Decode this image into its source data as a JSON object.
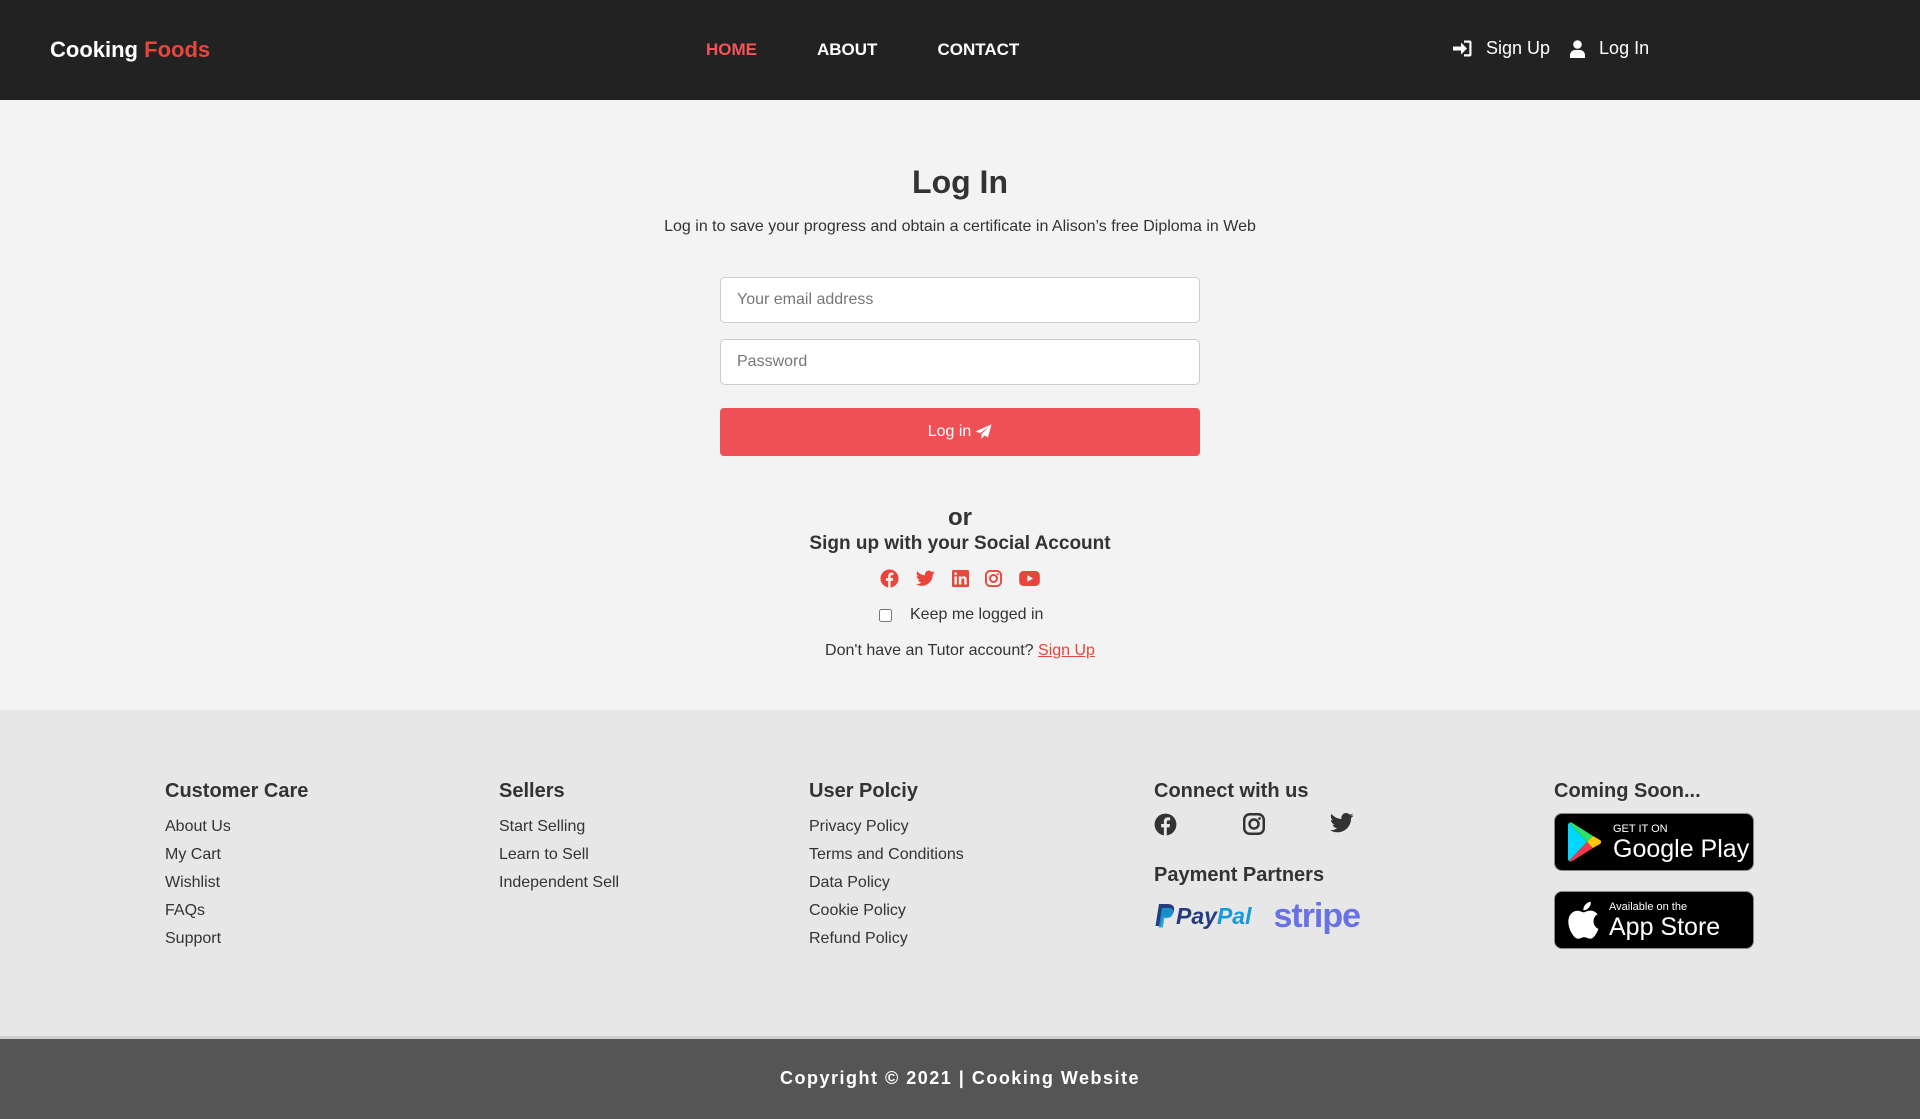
{
  "header": {
    "brand_part1": "Cooking",
    "brand_part2": "Foods",
    "nav": [
      {
        "label": "HOME",
        "active": true
      },
      {
        "label": "ABOUT",
        "active": false
      },
      {
        "label": "CONTACT",
        "active": false
      }
    ],
    "signup_label": "Sign Up",
    "login_label": "Log In"
  },
  "login": {
    "title": "Log In",
    "subtitle": "Log in to save your progress and obtain a certificate in Alison’s free Diploma in Web",
    "email_placeholder": "Your email address",
    "password_placeholder": "Password",
    "button_label": "Log in",
    "or_label": "or",
    "social_title": "Sign up with your Social Account",
    "social_icons": [
      "facebook-icon",
      "twitter-icon",
      "linkedin-icon",
      "instagram-icon",
      "youtube-icon"
    ],
    "keep_logged_in": "Keep me logged in",
    "no_account_text": "Don't have an Tutor account?",
    "signup_link": "Sign Up"
  },
  "footer": {
    "customer_care": {
      "title": "Customer Care",
      "links": [
        "About Us",
        "My Cart",
        "Wishlist",
        "FAQs",
        "Support"
      ]
    },
    "sellers": {
      "title": "Sellers",
      "links": [
        "Start Selling",
        "Learn to Sell",
        "Independent Sell"
      ]
    },
    "user_policy": {
      "title": "User Polciy",
      "links": [
        "Privacy Policy",
        "Terms and Conditions",
        "Data Policy",
        "Cookie Policy",
        "Refund Policy"
      ]
    },
    "connect": {
      "title": "Connect with us",
      "icons": [
        "facebook-icon",
        "instagram-icon",
        "twitter-icon"
      ]
    },
    "payments": {
      "title": "Payment Partners",
      "paypal_part1": "Pay",
      "paypal_part2": "Pal",
      "stripe": "stripe"
    },
    "coming_soon": {
      "title": "Coming Soon...",
      "google_small": "GET IT ON",
      "google_big": "Google Play",
      "apple_small": "Available on the",
      "apple_big": "App Store"
    }
  },
  "copyright": "Copyright © 2021 | Cooking Website",
  "colors": {
    "accent": "#e8453c",
    "button": "#ef5056",
    "header_bg": "#222222",
    "footer_bg": "#e7e7e7",
    "copyright_bg": "#555555"
  }
}
